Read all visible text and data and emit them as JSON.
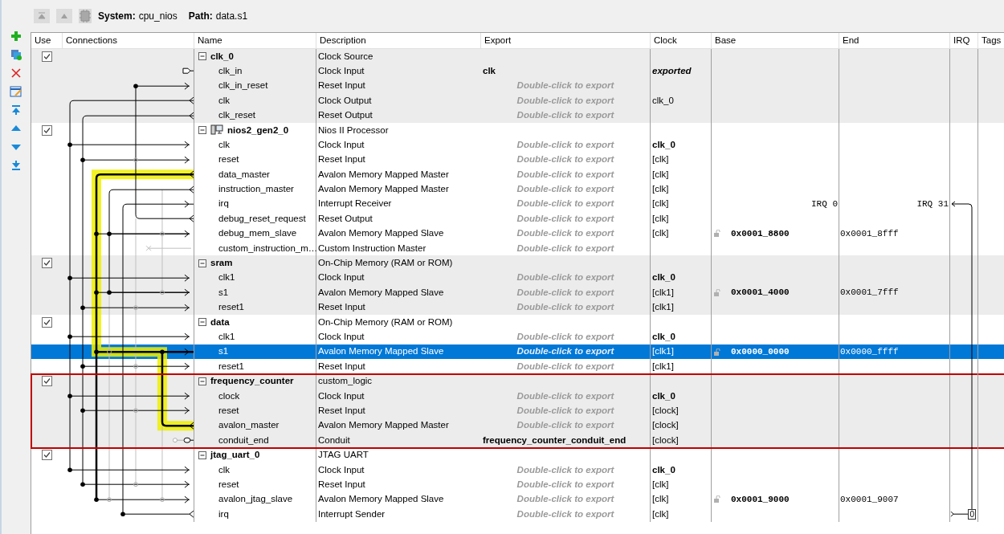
{
  "toolbar": {
    "system_label": "System:",
    "system": "cpu_nios",
    "path_label": "Path:",
    "path": "data.s1"
  },
  "columns": [
    "Use",
    "Connections",
    "Name",
    "Description",
    "Export",
    "Clock",
    "Base",
    "End",
    "IRQ",
    "Tags"
  ],
  "components": [
    {
      "name": "clk_0",
      "description": "Clock Source",
      "use": true,
      "expanded": true,
      "kind": "module",
      "selected": false,
      "outlined": false,
      "ports": [
        {
          "name": "clk_in",
          "description": "Clock Input",
          "export": "clk",
          "clock": "exported",
          "clock_bold": true,
          "clock_italic": true,
          "selected": false
        },
        {
          "name": "clk_in_reset",
          "description": "Reset Input",
          "placeholder": "Double-click to export",
          "selected": false
        },
        {
          "name": "clk",
          "description": "Clock Output",
          "placeholder": "Double-click to export",
          "clock": "clk_0",
          "clock_bold": false,
          "clock_italic": false,
          "selected": false
        },
        {
          "name": "clk_reset",
          "description": "Reset Output",
          "placeholder": "Double-click to export",
          "selected": false
        }
      ]
    },
    {
      "name": "nios2_gen2_0",
      "description": "Nios II Processor",
      "use": true,
      "expanded": true,
      "kind": "processor",
      "selected": false,
      "outlined": false,
      "ports": [
        {
          "name": "clk",
          "description": "Clock Input",
          "placeholder": "Double-click to export",
          "clock": "clk_0",
          "clock_bold": true,
          "clock_italic": false,
          "selected": false
        },
        {
          "name": "reset",
          "description": "Reset Input",
          "placeholder": "Double-click to export",
          "clock": "[clk]",
          "clock_bold": false,
          "clock_italic": false,
          "selected": false
        },
        {
          "name": "data_master",
          "description": "Avalon Memory Mapped Master",
          "placeholder": "Double-click to export",
          "clock": "[clk]",
          "clock_bold": false,
          "clock_italic": false,
          "selected": false
        },
        {
          "name": "instruction_master",
          "description": "Avalon Memory Mapped Master",
          "placeholder": "Double-click to export",
          "clock": "[clk]",
          "clock_bold": false,
          "clock_italic": false,
          "selected": false
        },
        {
          "name": "irq",
          "description": "Interrupt Receiver",
          "placeholder": "Double-click to export",
          "clock": "[clk]",
          "clock_bold": false,
          "clock_italic": false,
          "irq_from": "IRQ 0",
          "irq_to": "IRQ 31",
          "selected": false
        },
        {
          "name": "debug_reset_request",
          "description": "Reset Output",
          "placeholder": "Double-click to export",
          "clock": "[clk]",
          "clock_bold": false,
          "clock_italic": false,
          "selected": false
        },
        {
          "name": "debug_mem_slave",
          "description": "Avalon Memory Mapped Slave",
          "placeholder": "Double-click to export",
          "clock": "[clk]",
          "clock_bold": false,
          "clock_italic": false,
          "base": "0x0001_8800",
          "end": "0x0001_8fff",
          "selected": false
        },
        {
          "name": "custom_instruction_m…",
          "description": "Custom Instruction Master",
          "placeholder": "Double-click to export",
          "selected": false
        }
      ]
    },
    {
      "name": "sram",
      "description": "On-Chip Memory (RAM or ROM)",
      "use": true,
      "expanded": true,
      "kind": "module",
      "selected": false,
      "outlined": false,
      "ports": [
        {
          "name": "clk1",
          "description": "Clock Input",
          "placeholder": "Double-click to export",
          "clock": "clk_0",
          "clock_bold": true,
          "clock_italic": false,
          "selected": false
        },
        {
          "name": "s1",
          "description": "Avalon Memory Mapped Slave",
          "placeholder": "Double-click to export",
          "clock": "[clk1]",
          "clock_bold": false,
          "clock_italic": false,
          "base": "0x0001_4000",
          "end": "0x0001_7fff",
          "selected": false
        },
        {
          "name": "reset1",
          "description": "Reset Input",
          "placeholder": "Double-click to export",
          "clock": "[clk1]",
          "clock_bold": false,
          "clock_italic": false,
          "selected": false
        }
      ]
    },
    {
      "name": "data",
      "description": "On-Chip Memory (RAM or ROM)",
      "use": true,
      "expanded": true,
      "kind": "module",
      "selected": false,
      "outlined": false,
      "ports": [
        {
          "name": "clk1",
          "description": "Clock Input",
          "placeholder": "Double-click to export",
          "clock": "clk_0",
          "clock_bold": true,
          "clock_italic": false,
          "selected": false
        },
        {
          "name": "s1",
          "description": "Avalon Memory Mapped Slave",
          "placeholder": "Double-click to export",
          "clock": "[clk1]",
          "clock_bold": false,
          "clock_italic": false,
          "base": "0x0000_0000",
          "end": "0x0000_ffff",
          "selected": true
        },
        {
          "name": "reset1",
          "description": "Reset Input",
          "placeholder": "Double-click to export",
          "clock": "[clk1]",
          "clock_bold": false,
          "clock_italic": false,
          "selected": false
        }
      ]
    },
    {
      "name": "frequency_counter",
      "description": "custom_logic",
      "use": true,
      "expanded": true,
      "kind": "module",
      "selected": false,
      "outlined": true,
      "ports": [
        {
          "name": "clock",
          "description": "Clock Input",
          "placeholder": "Double-click to export",
          "clock": "clk_0",
          "clock_bold": true,
          "clock_italic": false,
          "selected": false
        },
        {
          "name": "reset",
          "description": "Reset Input",
          "placeholder": "Double-click to export",
          "clock": "[clock]",
          "clock_bold": false,
          "clock_italic": false,
          "selected": false
        },
        {
          "name": "avalon_master",
          "description": "Avalon Memory Mapped Master",
          "placeholder": "Double-click to export",
          "clock": "[clock]",
          "clock_bold": false,
          "clock_italic": false,
          "selected": false
        },
        {
          "name": "conduit_end",
          "description": "Conduit",
          "export": "frequency_counter_conduit_end",
          "clock": "[clock]",
          "clock_bold": false,
          "clock_italic": false,
          "selected": false
        }
      ]
    },
    {
      "name": "jtag_uart_0",
      "description": "JTAG UART",
      "use": true,
      "expanded": true,
      "kind": "module",
      "selected": false,
      "outlined": false,
      "ports": [
        {
          "name": "clk",
          "description": "Clock Input",
          "placeholder": "Double-click to export",
          "clock": "clk_0",
          "clock_bold": true,
          "clock_italic": false,
          "selected": false
        },
        {
          "name": "reset",
          "description": "Reset Input",
          "placeholder": "Double-click to export",
          "clock": "[clk]",
          "clock_bold": false,
          "clock_italic": false,
          "selected": false
        },
        {
          "name": "avalon_jtag_slave",
          "description": "Avalon Memory Mapped Slave",
          "placeholder": "Double-click to export",
          "clock": "[clk]",
          "clock_bold": false,
          "clock_italic": false,
          "base": "0x0001_9000",
          "end": "0x0001_9007",
          "selected": false
        },
        {
          "name": "irq",
          "description": "Interrupt Sender",
          "placeholder": "Double-click to export",
          "clock": "[clk]",
          "clock_bold": false,
          "clock_italic": false,
          "irq": "0",
          "selected": false
        }
      ]
    }
  ]
}
